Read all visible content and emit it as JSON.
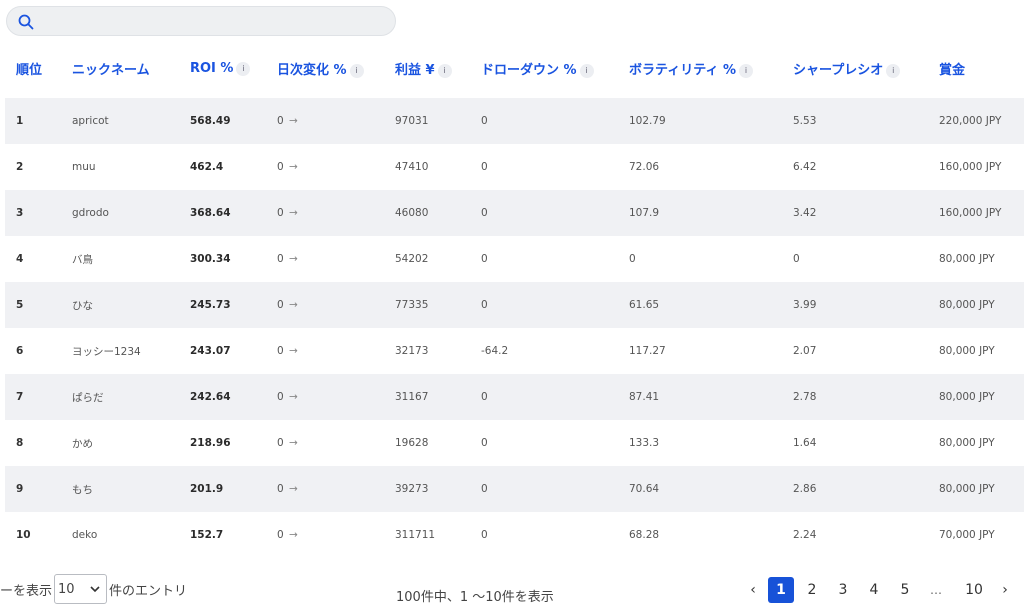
{
  "search": {
    "placeholder": ""
  },
  "columns": [
    "順位",
    "ニックネーム",
    "ROI %",
    "日次変化 %",
    "利益 ¥",
    "ドローダウン %",
    "ボラティリティ %",
    "シャープレシオ",
    "賞金"
  ],
  "info_mark": "i",
  "arrow": "→",
  "rows": [
    {
      "rank": "1",
      "name": "apricot",
      "roi": "568.49",
      "daily": "0",
      "profit": "97031",
      "drawdown": "0",
      "volatility": "102.79",
      "sharpe": "5.53",
      "prize": "220,000 JPY"
    },
    {
      "rank": "2",
      "name": "muu",
      "roi": "462.4",
      "daily": "0",
      "profit": "47410",
      "drawdown": "0",
      "volatility": "72.06",
      "sharpe": "6.42",
      "prize": "160,000 JPY"
    },
    {
      "rank": "3",
      "name": "gdrodo",
      "roi": "368.64",
      "daily": "0",
      "profit": "46080",
      "drawdown": "0",
      "volatility": "107.9",
      "sharpe": "3.42",
      "prize": "160,000 JPY"
    },
    {
      "rank": "4",
      "name": "バ鳥",
      "roi": "300.34",
      "daily": "0",
      "profit": "54202",
      "drawdown": "0",
      "volatility": "0",
      "sharpe": "0",
      "prize": "80,000 JPY"
    },
    {
      "rank": "5",
      "name": "ひな",
      "roi": "245.73",
      "daily": "0",
      "profit": "77335",
      "drawdown": "0",
      "volatility": "61.65",
      "sharpe": "3.99",
      "prize": "80,000 JPY"
    },
    {
      "rank": "6",
      "name": "ヨッシー1234",
      "roi": "243.07",
      "daily": "0",
      "profit": "32173",
      "drawdown": "-64.2",
      "volatility": "117.27",
      "sharpe": "2.07",
      "prize": "80,000 JPY"
    },
    {
      "rank": "7",
      "name": "ぱらだ",
      "roi": "242.64",
      "daily": "0",
      "profit": "31167",
      "drawdown": "0",
      "volatility": "87.41",
      "sharpe": "2.78",
      "prize": "80,000 JPY"
    },
    {
      "rank": "8",
      "name": "かめ",
      "roi": "218.96",
      "daily": "0",
      "profit": "19628",
      "drawdown": "0",
      "volatility": "133.3",
      "sharpe": "1.64",
      "prize": "80,000 JPY"
    },
    {
      "rank": "9",
      "name": "もち",
      "roi": "201.9",
      "daily": "0",
      "profit": "39273",
      "drawdown": "0",
      "volatility": "70.64",
      "sharpe": "2.86",
      "prize": "80,000 JPY"
    },
    {
      "rank": "10",
      "name": "deko",
      "roi": "152.7",
      "daily": "0",
      "profit": "311711",
      "drawdown": "0",
      "volatility": "68.28",
      "sharpe": "2.24",
      "prize": "70,000 JPY"
    }
  ],
  "footer": {
    "show_prefix": "ーを表示",
    "page_size": "10",
    "show_suffix": "件のエントリ",
    "summary": "100件中、1 〜10件を表示",
    "pages": [
      "1",
      "2",
      "3",
      "4",
      "5",
      "…",
      "10"
    ],
    "prev": "‹",
    "next": "›"
  },
  "colors": {
    "accent": "#1a54e0",
    "active_page": "#1752d8",
    "row_stripe": "#f0f1f4"
  }
}
